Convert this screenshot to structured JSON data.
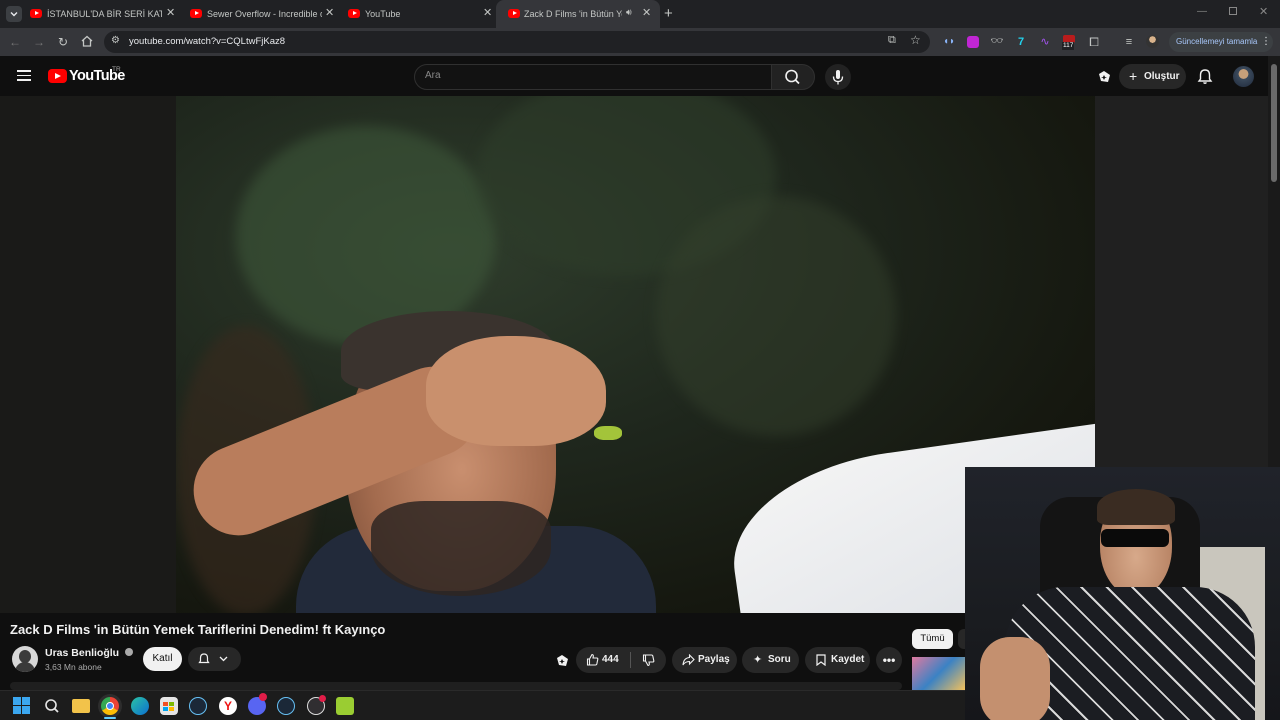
{
  "browser": {
    "tabs": [
      {
        "title": "İSTANBUL'DA BİR SERİ KATİL - Ja",
        "active": false
      },
      {
        "title": "Sewer Overflow - Incredible dis",
        "active": false
      },
      {
        "title": "YouTube",
        "active": false
      },
      {
        "title": "Zack D Films 'in Bütün Yem",
        "active": true
      }
    ],
    "url": "youtube.com/watch?v=CQLtwFjKaz8",
    "update_button": "Güncellemeyi tamamla",
    "extension_badge": "117"
  },
  "header": {
    "logo_text": "YouTube",
    "region": "TR",
    "search_placeholder": "Ara",
    "create_label": "Oluştur"
  },
  "video": {
    "title": "Zack D Films 'in Bütün Yemek Tariflerini Denedim! ft Kayınço",
    "channel": "Uras Benlioğlu",
    "subscribers": "3,63 Mn abone",
    "join_label": "Katıl",
    "likes": "444",
    "share_label": "Paylaş",
    "ask_label": "Soru",
    "save_label": "Kaydet"
  },
  "sidebar": {
    "chip_all": "Tümü"
  },
  "colors": {
    "brand_red": "#ff0000",
    "background": "#0f0f0f",
    "surface": "#272727",
    "accent_blue": "#a8c7fa"
  }
}
